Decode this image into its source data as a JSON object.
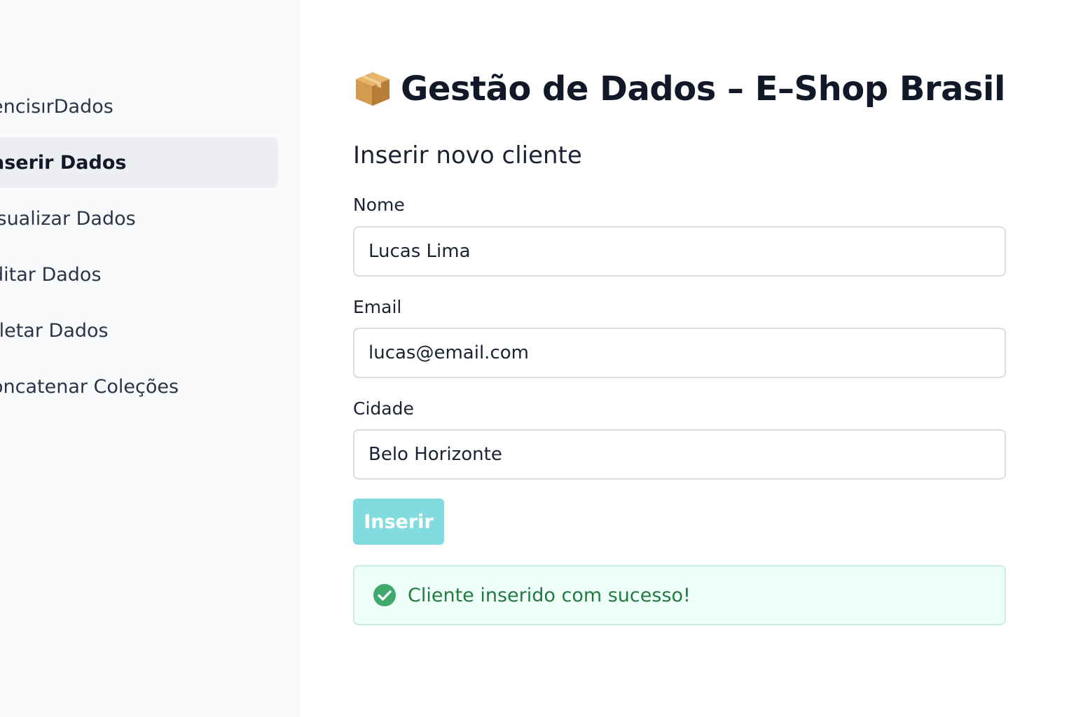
{
  "sidebar": {
    "items": [
      {
        "label": "GerencisırDados",
        "visible_label": "encisırDados",
        "active": false
      },
      {
        "label": "Inserir Dados",
        "visible_label": "aserir Dados",
        "active": true
      },
      {
        "label": "Visualizar Dados",
        "visible_label": "isualizar Dados",
        "active": false
      },
      {
        "label": "Editar Dados",
        "visible_label": "ditar Dados",
        "active": false
      },
      {
        "label": "Deletar Dados",
        "visible_label": "eletar Dados",
        "active": false
      },
      {
        "label": "Concatenar Coleções",
        "visible_label": "oncatenar Coleções",
        "active": false
      }
    ]
  },
  "header": {
    "icon": "package-box-icon",
    "title": "Gestão de Dados – E–Shop Brasil"
  },
  "form": {
    "section_title": "Inserir novo cliente",
    "fields": [
      {
        "label": "Nome",
        "value": "Lucas Lima"
      },
      {
        "label": "Email",
        "value": "lucas@email.com"
      },
      {
        "label": "Cidade",
        "value": "Belo Horizonte"
      }
    ],
    "submit_label": "Inserir"
  },
  "alert": {
    "icon": "check-circle-icon",
    "message": "Cliente inserido com sucesso!"
  },
  "colors": {
    "accent_button": "#82dcdf",
    "success_text": "#217a3f",
    "success_bg": "#effff9",
    "success_icon": "#3fa86b",
    "sidebar_bg": "#f9fafc",
    "active_item_bg": "#eceef2"
  }
}
